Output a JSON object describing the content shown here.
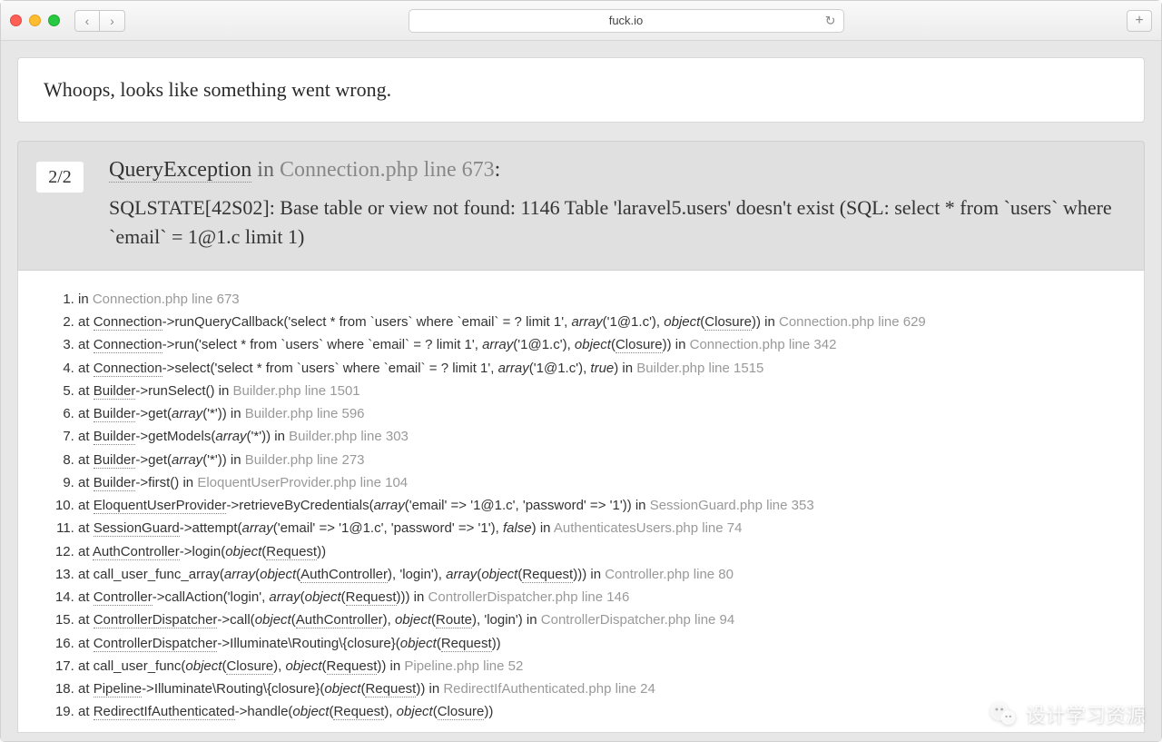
{
  "browser": {
    "url": "fuck.io"
  },
  "whoops": "Whoops, looks like something went wrong.",
  "exception": {
    "count": "2/2",
    "type": "QueryException",
    "in_word": "in",
    "location": "Connection.php line 673",
    "colon": ":",
    "message": "SQLSTATE[42S02]: Base table or view not found: 1146 Table 'laravel5.users' doesn't exist (SQL: select * from `users` where `email` = 1@1.c limit 1)"
  },
  "trace": [
    {
      "n": 1,
      "segs": [
        {
          "t": "plain",
          "v": "in "
        },
        {
          "t": "loc",
          "v": "Connection.php line 673"
        }
      ]
    },
    {
      "n": 2,
      "segs": [
        {
          "t": "plain",
          "v": "at "
        },
        {
          "t": "cls",
          "v": "Connection"
        },
        {
          "t": "plain",
          "v": "->runQueryCallback('select * from `users` where `email` = ? limit 1', "
        },
        {
          "t": "italic",
          "v": "array"
        },
        {
          "t": "plain",
          "v": "('1@1.c'), "
        },
        {
          "t": "italic",
          "v": "object"
        },
        {
          "t": "plain",
          "v": "("
        },
        {
          "t": "cls",
          "v": "Closure"
        },
        {
          "t": "plain",
          "v": ")) in "
        },
        {
          "t": "loc",
          "v": "Connection.php line 629"
        }
      ]
    },
    {
      "n": 3,
      "segs": [
        {
          "t": "plain",
          "v": "at "
        },
        {
          "t": "cls",
          "v": "Connection"
        },
        {
          "t": "plain",
          "v": "->run('select * from `users` where `email` = ? limit 1', "
        },
        {
          "t": "italic",
          "v": "array"
        },
        {
          "t": "plain",
          "v": "('1@1.c'), "
        },
        {
          "t": "italic",
          "v": "object"
        },
        {
          "t": "plain",
          "v": "("
        },
        {
          "t": "cls",
          "v": "Closure"
        },
        {
          "t": "plain",
          "v": ")) in "
        },
        {
          "t": "loc",
          "v": "Connection.php line 342"
        }
      ]
    },
    {
      "n": 4,
      "segs": [
        {
          "t": "plain",
          "v": "at "
        },
        {
          "t": "cls",
          "v": "Connection"
        },
        {
          "t": "plain",
          "v": "->select('select * from `users` where `email` = ? limit 1', "
        },
        {
          "t": "italic",
          "v": "array"
        },
        {
          "t": "plain",
          "v": "('1@1.c'), "
        },
        {
          "t": "italic",
          "v": "true"
        },
        {
          "t": "plain",
          "v": ") in "
        },
        {
          "t": "loc",
          "v": "Builder.php line 1515"
        }
      ]
    },
    {
      "n": 5,
      "segs": [
        {
          "t": "plain",
          "v": "at "
        },
        {
          "t": "cls",
          "v": "Builder"
        },
        {
          "t": "plain",
          "v": "->runSelect() in "
        },
        {
          "t": "loc",
          "v": "Builder.php line 1501"
        }
      ]
    },
    {
      "n": 6,
      "segs": [
        {
          "t": "plain",
          "v": "at "
        },
        {
          "t": "cls",
          "v": "Builder"
        },
        {
          "t": "plain",
          "v": "->get("
        },
        {
          "t": "italic",
          "v": "array"
        },
        {
          "t": "plain",
          "v": "('*')) in "
        },
        {
          "t": "loc",
          "v": "Builder.php line 596"
        }
      ]
    },
    {
      "n": 7,
      "segs": [
        {
          "t": "plain",
          "v": "at "
        },
        {
          "t": "cls",
          "v": "Builder"
        },
        {
          "t": "plain",
          "v": "->getModels("
        },
        {
          "t": "italic",
          "v": "array"
        },
        {
          "t": "plain",
          "v": "('*')) in "
        },
        {
          "t": "loc",
          "v": "Builder.php line 303"
        }
      ]
    },
    {
      "n": 8,
      "segs": [
        {
          "t": "plain",
          "v": "at "
        },
        {
          "t": "cls",
          "v": "Builder"
        },
        {
          "t": "plain",
          "v": "->get("
        },
        {
          "t": "italic",
          "v": "array"
        },
        {
          "t": "plain",
          "v": "('*')) in "
        },
        {
          "t": "loc",
          "v": "Builder.php line 273"
        }
      ]
    },
    {
      "n": 9,
      "segs": [
        {
          "t": "plain",
          "v": "at "
        },
        {
          "t": "cls",
          "v": "Builder"
        },
        {
          "t": "plain",
          "v": "->first() in "
        },
        {
          "t": "loc",
          "v": "EloquentUserProvider.php line 104"
        }
      ]
    },
    {
      "n": 10,
      "segs": [
        {
          "t": "plain",
          "v": "at "
        },
        {
          "t": "cls",
          "v": "EloquentUserProvider"
        },
        {
          "t": "plain",
          "v": "->retrieveByCredentials("
        },
        {
          "t": "italic",
          "v": "array"
        },
        {
          "t": "plain",
          "v": "('email' => '1@1.c', 'password' => '1')) in "
        },
        {
          "t": "loc",
          "v": "SessionGuard.php line 353"
        }
      ]
    },
    {
      "n": 11,
      "segs": [
        {
          "t": "plain",
          "v": "at "
        },
        {
          "t": "cls",
          "v": "SessionGuard"
        },
        {
          "t": "plain",
          "v": "->attempt("
        },
        {
          "t": "italic",
          "v": "array"
        },
        {
          "t": "plain",
          "v": "('email' => '1@1.c', 'password' => '1'), "
        },
        {
          "t": "italic",
          "v": "false"
        },
        {
          "t": "plain",
          "v": ") in "
        },
        {
          "t": "loc",
          "v": "AuthenticatesUsers.php line 74"
        }
      ]
    },
    {
      "n": 12,
      "segs": [
        {
          "t": "plain",
          "v": "at "
        },
        {
          "t": "cls",
          "v": "AuthController"
        },
        {
          "t": "plain",
          "v": "->login("
        },
        {
          "t": "italic",
          "v": "object"
        },
        {
          "t": "plain",
          "v": "("
        },
        {
          "t": "cls",
          "v": "Request"
        },
        {
          "t": "plain",
          "v": "))"
        }
      ]
    },
    {
      "n": 13,
      "segs": [
        {
          "t": "plain",
          "v": "at call_user_func_array("
        },
        {
          "t": "italic",
          "v": "array"
        },
        {
          "t": "plain",
          "v": "("
        },
        {
          "t": "italic",
          "v": "object"
        },
        {
          "t": "plain",
          "v": "("
        },
        {
          "t": "cls",
          "v": "AuthController"
        },
        {
          "t": "plain",
          "v": "), 'login'), "
        },
        {
          "t": "italic",
          "v": "array"
        },
        {
          "t": "plain",
          "v": "("
        },
        {
          "t": "italic",
          "v": "object"
        },
        {
          "t": "plain",
          "v": "("
        },
        {
          "t": "cls",
          "v": "Request"
        },
        {
          "t": "plain",
          "v": "))) in "
        },
        {
          "t": "loc",
          "v": "Controller.php line 80"
        }
      ]
    },
    {
      "n": 14,
      "segs": [
        {
          "t": "plain",
          "v": "at "
        },
        {
          "t": "cls",
          "v": "Controller"
        },
        {
          "t": "plain",
          "v": "->callAction('login', "
        },
        {
          "t": "italic",
          "v": "array"
        },
        {
          "t": "plain",
          "v": "("
        },
        {
          "t": "italic",
          "v": "object"
        },
        {
          "t": "plain",
          "v": "("
        },
        {
          "t": "cls",
          "v": "Request"
        },
        {
          "t": "plain",
          "v": "))) in "
        },
        {
          "t": "loc",
          "v": "ControllerDispatcher.php line 146"
        }
      ]
    },
    {
      "n": 15,
      "segs": [
        {
          "t": "plain",
          "v": "at "
        },
        {
          "t": "cls",
          "v": "ControllerDispatcher"
        },
        {
          "t": "plain",
          "v": "->call("
        },
        {
          "t": "italic",
          "v": "object"
        },
        {
          "t": "plain",
          "v": "("
        },
        {
          "t": "cls",
          "v": "AuthController"
        },
        {
          "t": "plain",
          "v": "), "
        },
        {
          "t": "italic",
          "v": "object"
        },
        {
          "t": "plain",
          "v": "("
        },
        {
          "t": "cls",
          "v": "Route"
        },
        {
          "t": "plain",
          "v": "), 'login') in "
        },
        {
          "t": "loc",
          "v": "ControllerDispatcher.php line 94"
        }
      ]
    },
    {
      "n": 16,
      "segs": [
        {
          "t": "plain",
          "v": "at "
        },
        {
          "t": "cls",
          "v": "ControllerDispatcher"
        },
        {
          "t": "plain",
          "v": "->Illuminate\\Routing\\{closure}("
        },
        {
          "t": "italic",
          "v": "object"
        },
        {
          "t": "plain",
          "v": "("
        },
        {
          "t": "cls",
          "v": "Request"
        },
        {
          "t": "plain",
          "v": "))"
        }
      ]
    },
    {
      "n": 17,
      "segs": [
        {
          "t": "plain",
          "v": "at call_user_func("
        },
        {
          "t": "italic",
          "v": "object"
        },
        {
          "t": "plain",
          "v": "("
        },
        {
          "t": "cls",
          "v": "Closure"
        },
        {
          "t": "plain",
          "v": "), "
        },
        {
          "t": "italic",
          "v": "object"
        },
        {
          "t": "plain",
          "v": "("
        },
        {
          "t": "cls",
          "v": "Request"
        },
        {
          "t": "plain",
          "v": ")) in "
        },
        {
          "t": "loc",
          "v": "Pipeline.php line 52"
        }
      ]
    },
    {
      "n": 18,
      "segs": [
        {
          "t": "plain",
          "v": "at "
        },
        {
          "t": "cls",
          "v": "Pipeline"
        },
        {
          "t": "plain",
          "v": "->Illuminate\\Routing\\{closure}("
        },
        {
          "t": "italic",
          "v": "object"
        },
        {
          "t": "plain",
          "v": "("
        },
        {
          "t": "cls",
          "v": "Request"
        },
        {
          "t": "plain",
          "v": ")) in "
        },
        {
          "t": "loc",
          "v": "RedirectIfAuthenticated.php line 24"
        }
      ]
    },
    {
      "n": 19,
      "segs": [
        {
          "t": "plain",
          "v": "at "
        },
        {
          "t": "cls",
          "v": "RedirectIfAuthenticated"
        },
        {
          "t": "plain",
          "v": "->handle("
        },
        {
          "t": "italic",
          "v": "object"
        },
        {
          "t": "plain",
          "v": "("
        },
        {
          "t": "cls",
          "v": "Request"
        },
        {
          "t": "plain",
          "v": "), "
        },
        {
          "t": "italic",
          "v": "object"
        },
        {
          "t": "plain",
          "v": "("
        },
        {
          "t": "cls",
          "v": "Closure"
        },
        {
          "t": "plain",
          "v": "))"
        }
      ]
    }
  ],
  "watermark": "设计学习资源"
}
